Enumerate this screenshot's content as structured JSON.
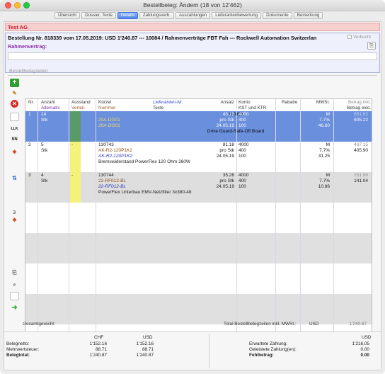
{
  "window": {
    "title": "Bestellbeleg: Ändern (18 von 12'462)"
  },
  "tabs": [
    {
      "label": "Übersicht",
      "active": false
    },
    {
      "label": "Dossier, Texte",
      "active": false
    },
    {
      "label": "Details",
      "active": true
    },
    {
      "label": "Zahlungsverb.",
      "active": false
    },
    {
      "label": "Auszahlungen",
      "active": false
    },
    {
      "label": "Lieferantenbewertung",
      "active": false
    },
    {
      "label": "Dokumente",
      "active": false
    },
    {
      "label": "Bemerkung",
      "active": false
    }
  ],
  "company": "Test AG",
  "order": {
    "header": "Bestellung Nr. 818339 vom 17.05.2019: USD 1'240.87 --- 10084 / Rahmenverträge FBT Fah --- Rockwell Automation Switzerlan",
    "verbucht_label": "Verbucht",
    "rahmen_label": "Rahmenvertrag:",
    "rahmen_value": ""
  },
  "section_label": "Bestellbelegzeilen",
  "toolbar": {
    "llk": "LLK",
    "sn": "SN",
    "line_count": "3"
  },
  "columns": {
    "nr": "Nr.",
    "anzahl": "Anzahl",
    "alternativ": "Alternativ",
    "ausstand": "Ausstand",
    "verteil": "Verteil.",
    "kuerzel": "Kürzel",
    "nummer": "Nummer",
    "lieferanten_nr": "Lieferanten-Nr.",
    "texte": "Texte",
    "ansatz": "Ansatz",
    "konto": "Konto",
    "kst_ktr": "KST und KTR",
    "rabatte": "Rabatte",
    "mwst": "MWSt.",
    "betrag_inkl": "Betrag inkl.",
    "betrag_exkl": "Betrag exkl."
  },
  "rows": [
    {
      "nr": "1",
      "anzahl": "14",
      "einheit": "Stk",
      "ausstand": "",
      "kuerzel": "110805",
      "nummer": "20A-DG01",
      "lieferanten_nr": "20A-DG01",
      "text": "Drive Guard-Safe-Off Board",
      "ansatz": "43.23",
      "ansatz_unit": "pro Stk",
      "datum": "24.05.19",
      "konto": "4000",
      "kst": "400",
      "ktr": "100",
      "mwst_code": "M",
      "mwst_rate": "7.7%",
      "mwst_amount": "46.60",
      "betrag_inkl": "651.62",
      "betrag_exkl": "605.22",
      "status_color": "#5a9a68",
      "style": "selected"
    },
    {
      "nr": "2",
      "anzahl": "5",
      "einheit": "Stk",
      "ausstand": "-",
      "kuerzel": "130743",
      "nummer": "AK-R2-120P1K2",
      "lieferanten_nr": "AK-R2-120P1K2",
      "text": "Bremswiderstand PowerFlex 120 Ohm 260W",
      "ansatz": "81.18",
      "ansatz_unit": "pro Stk",
      "datum": "24.05.19",
      "konto": "4000",
      "kst": "400",
      "ktr": "100",
      "mwst_code": "M",
      "mwst_rate": "7.7%",
      "mwst_amount": "31.25",
      "betrag_inkl": "437.15",
      "betrag_exkl": "405.90",
      "status_color": "#f4f27a",
      "style": "white"
    },
    {
      "nr": "3",
      "anzahl": "4",
      "einheit": "Stk",
      "ausstand": "-",
      "kuerzel": "130744",
      "nummer": "22-RF012-BL",
      "lieferanten_nr": "22-RF012-BL",
      "text": "PowerFlex Unterbau EMV-Netzfilter 3x380-48",
      "ansatz": "35.26",
      "ansatz_unit": "pro Stk",
      "datum": "24.05.19",
      "konto": "4000",
      "kst": "400",
      "ktr": "100",
      "mwst_code": "M",
      "mwst_rate": "7.7%",
      "mwst_amount": "10.86",
      "betrag_inkl": "151.90",
      "betrag_exkl": "141.04",
      "status_color": "#f4f27a",
      "style": "grey"
    }
  ],
  "footer": {
    "gesamtgewicht_label": "Gesamtgewicht:",
    "total_label": "Total Bestellbelegzeilen inkl. MWSt.:",
    "total_currency": "USD",
    "total_value": "1'240.87"
  },
  "totals": {
    "chf_header": "CHF",
    "usd_header": "USD",
    "labels": [
      "Belegnetto:",
      "Mehrwertsteuer:",
      "Belegtotal:"
    ],
    "chf": [
      "1'152.16",
      "88.71",
      "1'240.87"
    ],
    "usd": [
      "1'152.16",
      "88.71",
      "1'240.87"
    ],
    "right_currency": "USD",
    "right_labels": [
      "Erwartete Zahlung:",
      "Geleistete Zahlung(en):",
      "Fehlbetrag:"
    ],
    "right_values": [
      "1'216.05",
      "0.00",
      "0.00"
    ]
  }
}
